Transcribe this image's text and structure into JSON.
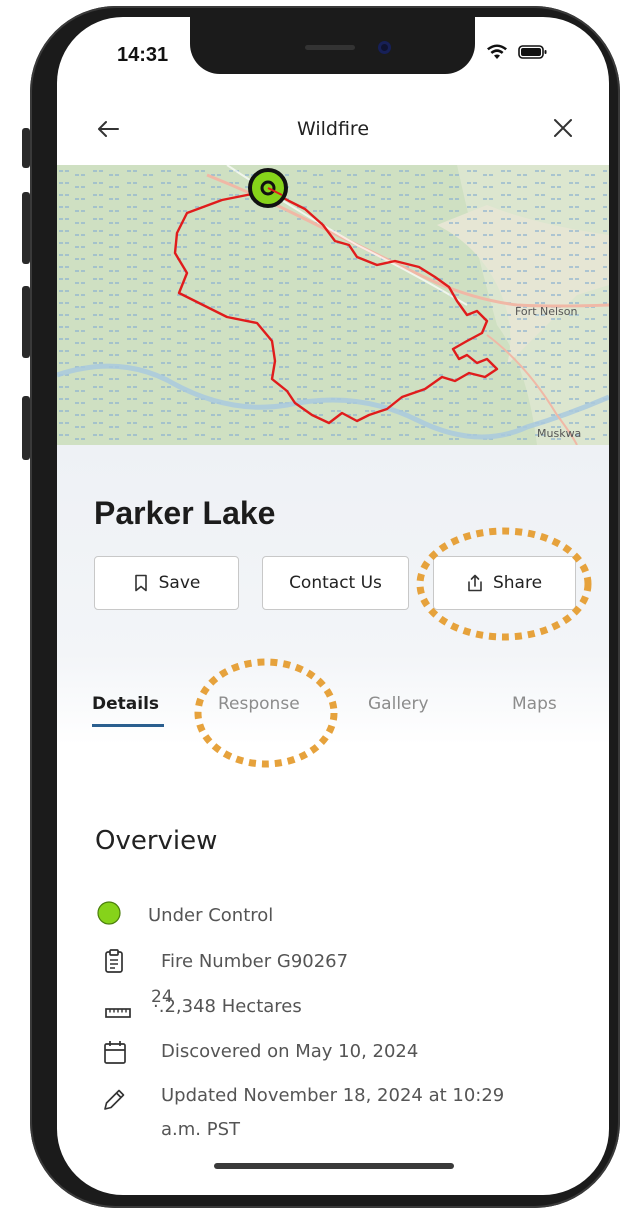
{
  "status_bar": {
    "time": "14:31"
  },
  "nav": {
    "title": "Wildfire"
  },
  "map": {
    "labels": [
      "Fort Nelson",
      "Muskwa"
    ]
  },
  "fire": {
    "name": "Parker Lake"
  },
  "actions": {
    "save": "Save",
    "contact": "Contact Us",
    "share": "Share"
  },
  "tabs": [
    "Details",
    "Response",
    "Gallery",
    "Maps"
  ],
  "active_tab": "Details",
  "overview": {
    "title": "Overview",
    "status": "Under Control",
    "fire_number": "Fire Number G90267",
    "hectares_badge": "24",
    "hectares": "·.2,348 Hectares",
    "discovered": "Discovered on May 10, 2024",
    "updated_line1": "Updated November 18, 2024 at 10:29",
    "updated_line2": "a.m. PST"
  },
  "colors": {
    "status_green": "#86d31a",
    "fire_perimeter": "#e01c1c",
    "annotation": "#e6a23c",
    "tab_underline": "#2b5f8f"
  },
  "icons": [
    "back-arrow-icon",
    "close-icon",
    "bookmark-icon",
    "share-icon",
    "clipboard-icon",
    "ruler-icon",
    "calendar-icon",
    "pencil-icon"
  ]
}
